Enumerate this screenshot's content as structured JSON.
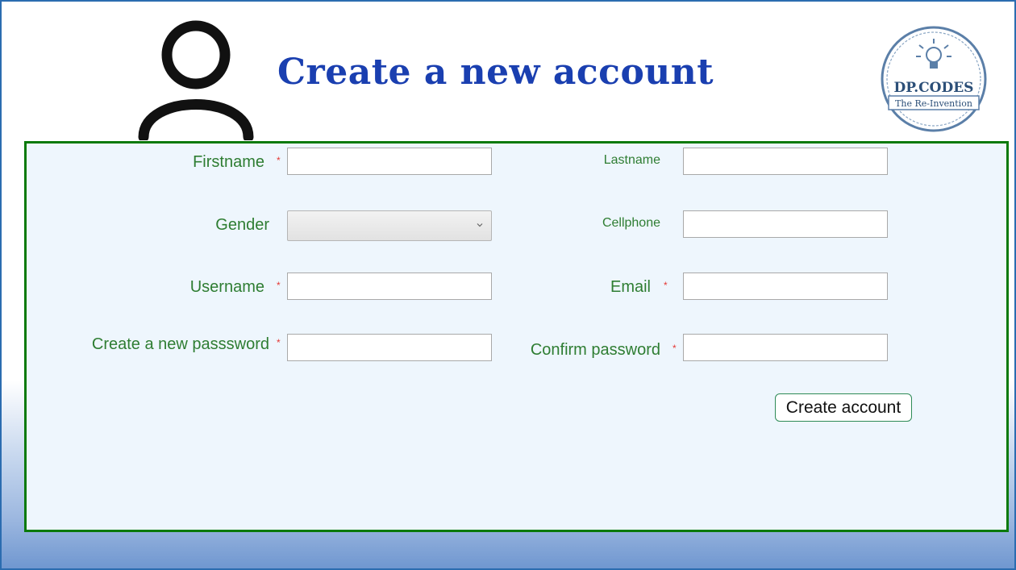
{
  "header": {
    "title": "Create a new account",
    "avatar_icon": "user-outline-icon",
    "logo": {
      "line1": "DP.CODES",
      "line2": "The Re-Invention",
      "icon": "lightbulb-icon"
    }
  },
  "form": {
    "required_marker": "*",
    "firstname": {
      "label": "Firstname",
      "value": "",
      "required": true
    },
    "lastname": {
      "label": "Lastname",
      "value": "",
      "required": false
    },
    "gender": {
      "label": "Gender",
      "selected": "",
      "required": false
    },
    "cellphone": {
      "label": "Cellphone",
      "value": "",
      "required": false
    },
    "username": {
      "label": "Username",
      "value": "",
      "required": true
    },
    "email": {
      "label": "Email",
      "value": "",
      "required": true
    },
    "new_password": {
      "label": "Create a new passsword",
      "value": "",
      "required": true
    },
    "confirm_password": {
      "label": "Confirm password",
      "value": "",
      "required": true
    },
    "submit_label": "Create account"
  },
  "colors": {
    "title": "#1a3fb0",
    "label": "#2e7d32",
    "required": "#e53935",
    "panel_border": "#0a7a0a",
    "panel_bg": "#eef6fd",
    "window_border": "#2b6cb0"
  }
}
